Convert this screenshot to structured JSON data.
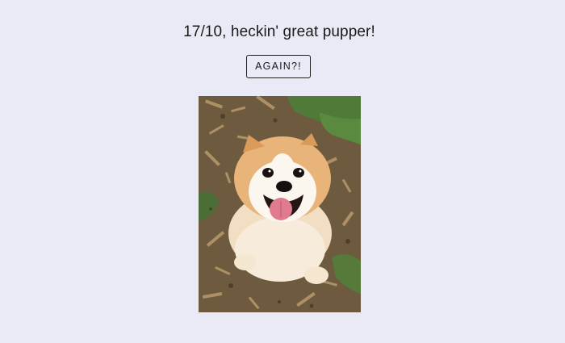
{
  "page": {
    "rating_text": "17/10, heckin' great pupper!",
    "again_button_label": "AGAIN?!",
    "photo_alt": "dog-photo"
  },
  "colors": {
    "background": "#e9eaf5",
    "text": "#1a1a1a",
    "button_border": "#1f1f1f"
  }
}
